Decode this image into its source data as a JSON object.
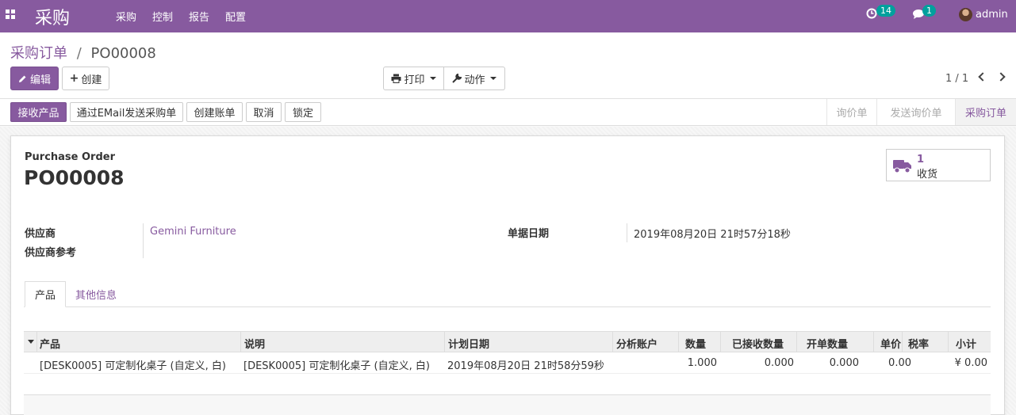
{
  "navbar": {
    "app_name": "采购",
    "menu": [
      "采购",
      "控制",
      "报告",
      "配置"
    ],
    "activity_badge": "14",
    "messages_badge": "1",
    "user": "admin",
    "icons": {
      "apps": "apps-grid-icon",
      "activity": "clock-icon",
      "messages": "chat-icon"
    }
  },
  "breadcrumb": {
    "parent": "采购订单",
    "separator": "/",
    "current": "PO00008"
  },
  "actions": {
    "edit": "编辑",
    "create": "创建",
    "print": "打印",
    "action": "动作"
  },
  "pager": {
    "value": "1 / 1"
  },
  "statusbar": {
    "buttons": [
      "接收产品",
      "通过EMail发送采购单",
      "创建账单",
      "取消",
      "锁定"
    ],
    "stages": [
      "询价单",
      "发送询价单",
      "采购订单"
    ],
    "active_stage": "采购订单"
  },
  "form": {
    "doc_type": "Purchase Order",
    "doc_name": "PO00008",
    "smart_button": {
      "count": "1",
      "label": "收货",
      "icon": "truck-icon"
    },
    "vendor_label": "供应商",
    "vendor_value": "Gemini Furniture",
    "vendor_ref_label": "供应商参考",
    "date_label": "单据日期",
    "date_value": "2019年08月20日 21时57分18秒"
  },
  "tabs": [
    "产品",
    "其他信息"
  ],
  "table": {
    "headers": [
      "产品",
      "说明",
      "计划日期",
      "分析账户",
      "数量",
      "已接收数量",
      "开单数量",
      "单价",
      "税率",
      "小计"
    ],
    "rows": [
      {
        "product": "[DESK0005] 可定制化桌子 (自定义, 白)",
        "description": "[DESK0005] 可定制化桌子 (自定义, 白)",
        "planned_date": "2019年08月20日 21时58分59秒",
        "account": "",
        "qty": "1.000",
        "received": "0.000",
        "billed": "0.000",
        "price": "0.00",
        "tax": "",
        "subtotal": "¥ 0.00"
      }
    ]
  },
  "colors": {
    "brand": "#875a9f",
    "badge": "#00a09d"
  }
}
